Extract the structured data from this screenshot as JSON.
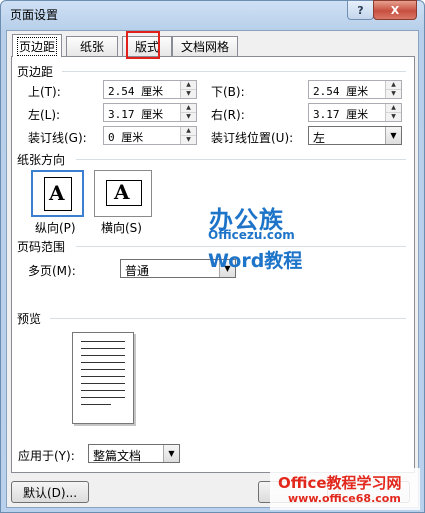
{
  "window": {
    "title": "页面设置",
    "help_glyph": "?",
    "close_glyph": "X"
  },
  "tabs": [
    {
      "label": "页边距",
      "active": true
    },
    {
      "label": "纸张"
    },
    {
      "label": "版式"
    },
    {
      "label": "文档网格"
    }
  ],
  "margins": {
    "heading": "页边距",
    "top_label": "上(T):",
    "top_value": "2.54 厘米",
    "bottom_label": "下(B):",
    "bottom_value": "2.54 厘米",
    "left_label": "左(L):",
    "left_value": "3.17 厘米",
    "right_label": "右(R):",
    "right_value": "3.17 厘米",
    "gutter_label": "装订线(G):",
    "gutter_value": "0 厘米",
    "gutter_pos_label": "装订线位置(U):",
    "gutter_pos_value": "左"
  },
  "orientation": {
    "heading": "纸张方向",
    "portrait_label": "纵向(P)",
    "landscape_label": "横向(S)",
    "glyph": "A"
  },
  "pages": {
    "heading": "页码范围",
    "multiple_label": "多页(M):",
    "multiple_value": "普通"
  },
  "preview": {
    "heading": "预览"
  },
  "apply": {
    "label": "应用于(Y):",
    "value": "整篇文档"
  },
  "footer": {
    "default_button": "默认(D)..."
  },
  "watermark": {
    "brand_cn": "办公族",
    "brand_url": "Officezu.com",
    "word_tutorial": "Word教程",
    "bottom_site_title": "Office教程学习网",
    "bottom_site_url": "www.office68.com"
  },
  "colors": {
    "highlight": "#e0201a",
    "brand_blue": "#1e74c8",
    "brand_red": "#e2281c"
  }
}
